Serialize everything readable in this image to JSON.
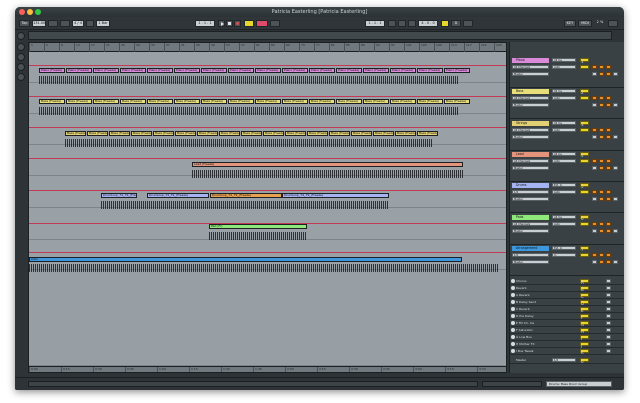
{
  "window": {
    "title": "Patricia Easterling  [Patricia Easterling]"
  },
  "transport": {
    "tap": "Tap",
    "tempo": "131.00",
    "sig": "4 / 4",
    "quantize": "1 Bar",
    "position": "1 . 1 . 1",
    "loop_start": "1 . 1 . 1",
    "loop_len": "4 . 0 . 0",
    "cpu": "KEY",
    "midi": "MIDI",
    "percent": "2 %",
    "key_map": "D"
  },
  "ruler": [
    "1",
    "5",
    "9",
    "13",
    "17",
    "21",
    "25",
    "29",
    "33",
    "37",
    "41",
    "45",
    "49",
    "53",
    "57",
    "61",
    "65",
    "69",
    "73",
    "77",
    "81",
    "85",
    "89",
    "93",
    "97",
    "101",
    "105",
    "109",
    "113",
    "117",
    "121",
    "125",
    "129"
  ],
  "bottom_ruler": [
    "0:00",
    "0:15",
    "0:30",
    "0:45",
    "1:00",
    "1:15",
    "1:30",
    "1:45",
    "2:00",
    "2:15",
    "2:30",
    "2:45",
    "3:00",
    "3:15",
    "3:30",
    "3:45"
  ],
  "tracks": [
    {
      "name": "Piano",
      "color": "#d98ad8",
      "clip_label": "Piano (Freeze)",
      "input": "All Ins",
      "channel": "All Channels",
      "monitor": "Auto",
      "output": "Master",
      "num": "1"
    },
    {
      "name": "Bass",
      "color": "#e7de7a",
      "clip_label": "Bass (Freeze)",
      "input": "All Ins",
      "channel": "All Channels",
      "monitor": "Auto",
      "output": "Master",
      "num": "2"
    },
    {
      "name": "Strings",
      "color": "#e3cf73",
      "clip_label": "Bass (Freeze)",
      "input": "All Ins",
      "channel": "All Channels",
      "monitor": "Auto",
      "output": "Master",
      "num": "3"
    },
    {
      "name": "Lead",
      "color": "#e3947a",
      "clip_label": "Lead (Freeze)",
      "input": "All Ins",
      "channel": "All Channels",
      "monitor": "Auto",
      "output": "Master",
      "num": "4"
    },
    {
      "name": "Drums",
      "color": "#a5b3f2",
      "clip_label": "Drumloop_74_79_(Freeze)",
      "input": "Ext. In",
      "channel": "1/2",
      "monitor": "Auto",
      "output": "Master",
      "num": "5"
    },
    {
      "name": "Pads",
      "color": "#8ee87a",
      "clip_label": "Pad (Fr)",
      "input": "All Ins",
      "channel": "All Channels",
      "monitor": "Auto",
      "output": "Master",
      "num": "6"
    },
    {
      "name": "Arrangement",
      "color": "#3c97dc",
      "clip_label": "Intro",
      "input": "Ext. In",
      "channel": "1/2",
      "monitor": "In",
      "output": "Master",
      "num": "7"
    }
  ],
  "returns": [
    {
      "name": "Chorus",
      "letter": "A"
    },
    {
      "name": "Reverb",
      "letter": "B"
    },
    {
      "name": "A Reverb",
      "letter": "C"
    },
    {
      "name": "B Delay Send",
      "letter": "D"
    },
    {
      "name": "C Reverb",
      "letter": "E"
    },
    {
      "name": "D Pre Delay",
      "letter": "F"
    },
    {
      "name": "E Fill Ch. Ins",
      "letter": "G"
    },
    {
      "name": "F Saturator",
      "letter": "H"
    },
    {
      "name": "G Low Bus",
      "letter": "I"
    },
    {
      "name": "H Mother FX",
      "letter": "J"
    },
    {
      "name": "I Bus Tweak",
      "letter": "K"
    }
  ],
  "master": {
    "name": "Master",
    "output": "1/2",
    "num": "0"
  },
  "status": {
    "left": "",
    "field": "Drums: Bass Drum Group"
  }
}
